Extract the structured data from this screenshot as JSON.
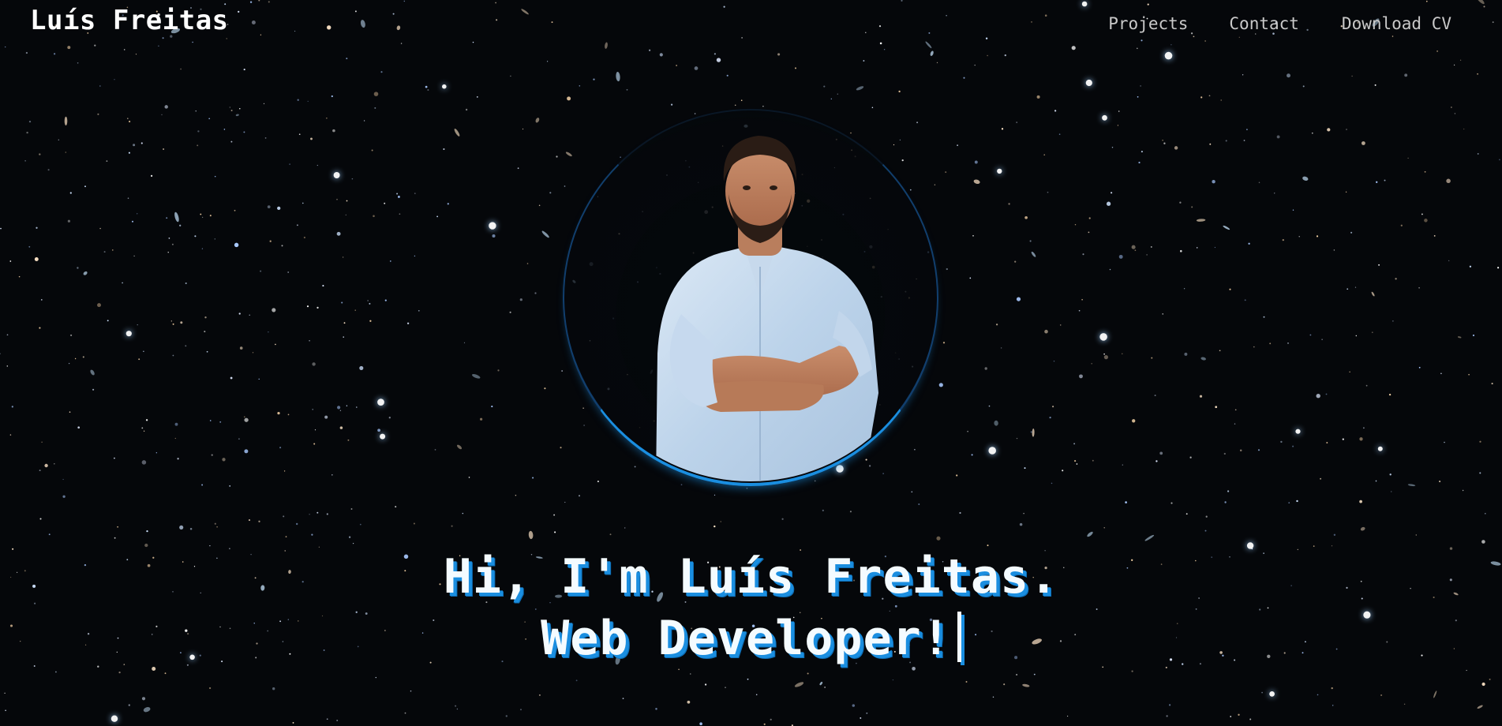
{
  "colors": {
    "background": "#05070a",
    "accent": "#1a8ee0",
    "heading_text": "#f4fbff",
    "nav_text": "#c9c9c9"
  },
  "header": {
    "brand": "Luís Freitas",
    "nav": {
      "projects": "Projects",
      "contact": "Contact",
      "download_cv": "Download CV"
    }
  },
  "hero": {
    "line1": "Hi, I'm Luís Freitas.",
    "line2": "Web Developer!"
  }
}
